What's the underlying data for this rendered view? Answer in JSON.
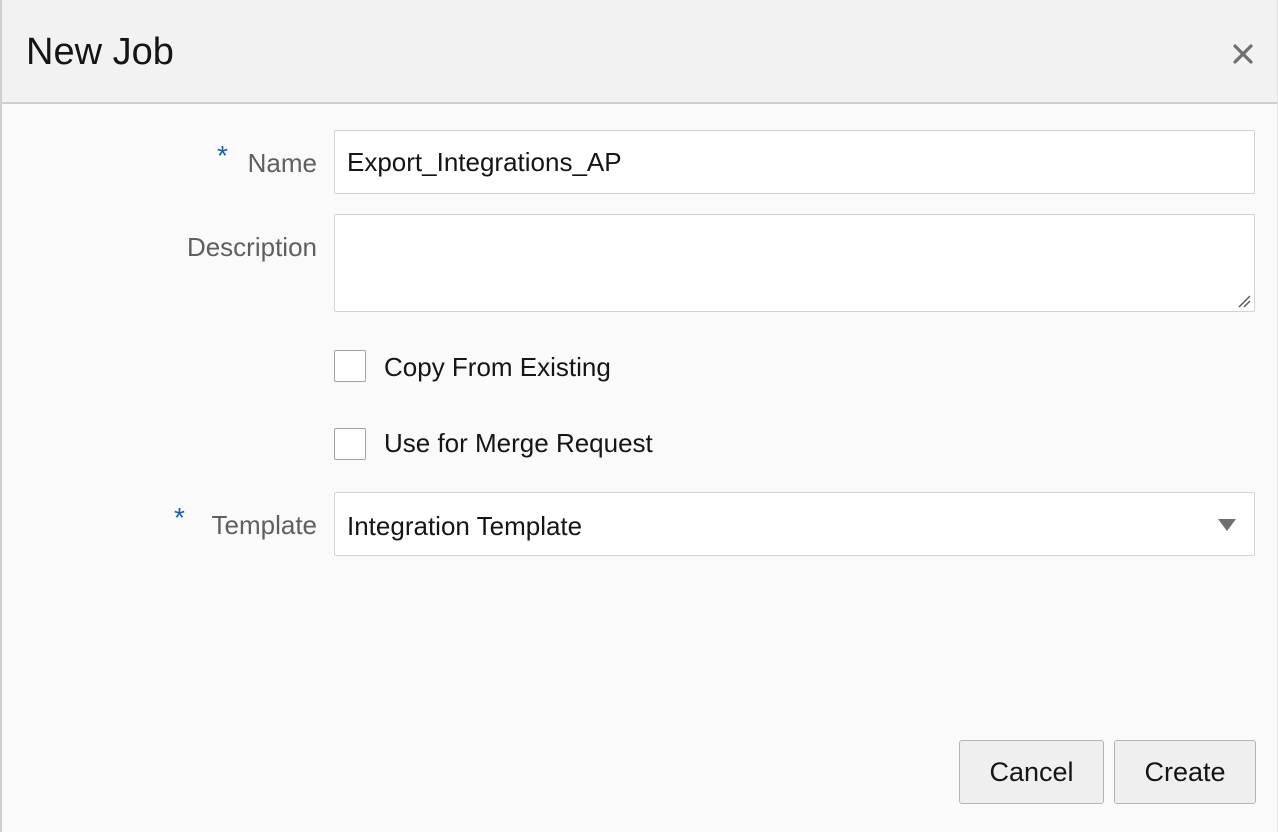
{
  "dialog": {
    "title": "New Job",
    "close_icon": "close-icon"
  },
  "form": {
    "name": {
      "label": "Name",
      "required_mark": "*",
      "value": "Export_Integrations_AP"
    },
    "description": {
      "label": "Description",
      "value": ""
    },
    "copy_from_existing": {
      "label": "Copy From Existing",
      "checked": false
    },
    "use_for_merge_request": {
      "label": "Use for Merge Request",
      "checked": false
    },
    "template": {
      "label": "Template",
      "required_mark": "*",
      "selected": "Integration Template",
      "icon": "chevron-down-icon"
    }
  },
  "footer": {
    "cancel_label": "Cancel",
    "create_label": "Create"
  },
  "colors": {
    "required_accent": "#1e5ea8",
    "header_bg": "#f2f2f2",
    "body_bg": "#fafafa"
  }
}
